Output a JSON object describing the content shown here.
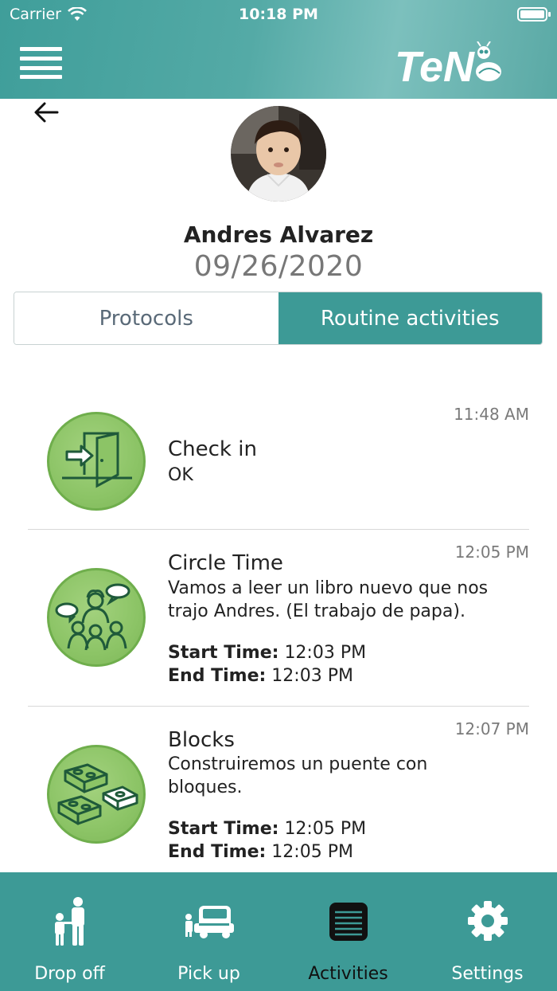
{
  "status_bar": {
    "carrier": "Carrier",
    "time": "10:18 PM"
  },
  "header": {
    "menu_icon": "hamburger-icon",
    "logo_text": "TeN"
  },
  "profile": {
    "name": "Andres Alvarez",
    "date": "09/26/2020"
  },
  "tabs": [
    {
      "label": "Protocols",
      "active": false
    },
    {
      "label": "Routine activities",
      "active": true
    }
  ],
  "activities": [
    {
      "icon": "check-in-door-icon",
      "time": "11:48 AM",
      "title": "Check in",
      "description": "OK"
    },
    {
      "icon": "circle-time-icon",
      "time": "12:05 PM",
      "title": "Circle Time",
      "description": "Vamos a leer un libro nuevo que nos trajo Andres. (El trabajo de papa).",
      "start_label": "Start Time:",
      "start_value": "12:03 PM",
      "end_label": "End Time:",
      "end_value": "12:03 PM"
    },
    {
      "icon": "blocks-icon",
      "time": "12:07 PM",
      "title": "Blocks",
      "description": "Construiremos un puente con bloques.",
      "start_label": "Start Time:",
      "start_value": "12:05 PM",
      "end_label": "End Time:",
      "end_value": "12:05 PM"
    }
  ],
  "bottom_nav": [
    {
      "label": "Drop off",
      "icon": "drop-off-icon",
      "active": false
    },
    {
      "label": "Pick up",
      "icon": "pick-up-icon",
      "active": false
    },
    {
      "label": "Activities",
      "icon": "activities-icon",
      "active": true
    },
    {
      "label": "Settings",
      "icon": "gear-icon",
      "active": false
    }
  ],
  "colors": {
    "teal": "#3d9a96",
    "green_icon": "#8cc466",
    "icon_stroke": "#1f5a3a"
  }
}
